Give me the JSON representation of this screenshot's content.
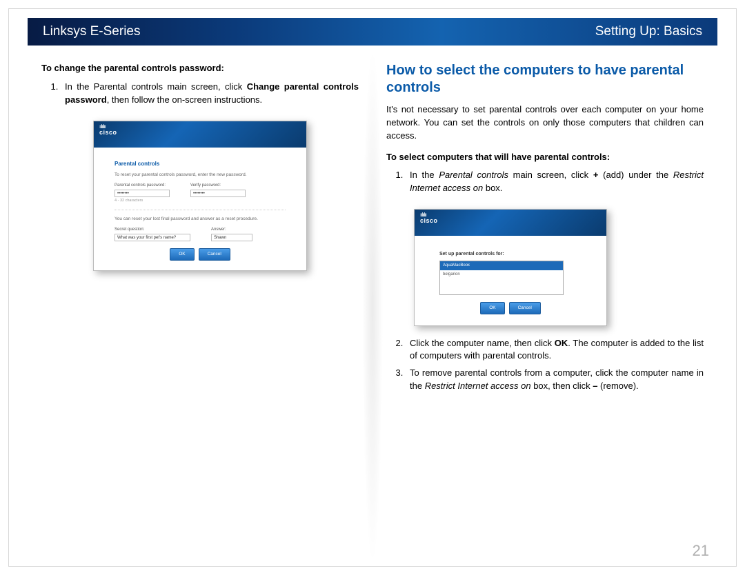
{
  "header": {
    "left": "Linksys E-Series",
    "right": "Setting Up: Basics"
  },
  "left_col": {
    "intro": "To change the parental controls password:",
    "step1_pre": "In the Parental controls main screen, click ",
    "step1_bold": "Change parental controls password",
    "step1_post": ", then follow the on-screen instructions.",
    "shot": {
      "logo_bars": "ıılıılıı",
      "logo_text": "cisco",
      "panel_title": "Parental controls",
      "instr": "To reset your parental controls password, enter the new password.",
      "pw_label": "Parental controls password:",
      "verify_label": "Verify password:",
      "pw_value": "••••••••",
      "hint": "4 - 32 characters",
      "sep_instr": "You can reset your lost final password and answer as a reset procedure.",
      "q_label": "Secret question:",
      "a_label": "Answer:",
      "q_value": "What was your first pet's name?",
      "a_value": "Shawn",
      "btn_ok": "OK",
      "btn_cancel": "Cancel"
    }
  },
  "right_col": {
    "heading": "How to select the computers to have parental controls",
    "para": "It's not necessary to set parental controls over each computer on your home network. You can set the controls on only those computers that children can access.",
    "intro": "To select computers that will have parental controls:",
    "step1_a": "In the ",
    "step1_i1": "Parental controls",
    "step1_b": " main screen, click ",
    "step1_bold": "+",
    "step1_c": " (add) under the ",
    "step1_i2": "Restrict Internet access on",
    "step1_d": " box.",
    "shot": {
      "logo_bars": "ıılıılıı",
      "logo_text": "cisco",
      "list_title": "Set up parental controls for:",
      "item_sel": "AquaMacBook",
      "item2": "belgarion",
      "btn_ok": "OK",
      "btn_cancel": "Cancel"
    },
    "step2_a": "Click the computer name, then click ",
    "step2_bold": "OK",
    "step2_b": ". The computer is added to the list of computers with parental controls.",
    "step3_a": "To remove parental controls from a computer, click the computer name in the ",
    "step3_i": "Restrict Internet access on",
    "step3_b": " box, then click ",
    "step3_bold": "–",
    "step3_c": " (remove)."
  },
  "page_number": "21"
}
